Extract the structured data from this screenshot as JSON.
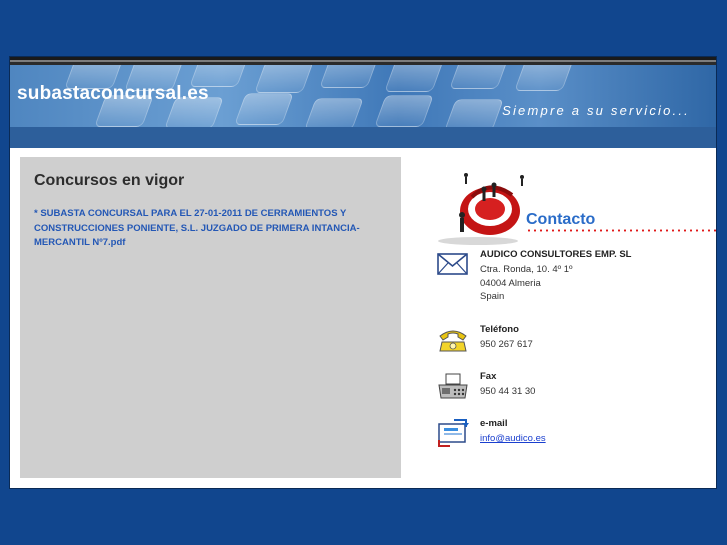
{
  "header": {
    "site_title": "subastaconcursal.es",
    "tagline": "Siempre a su servicio..."
  },
  "left_panel": {
    "heading": "Concursos en vigor",
    "link_text": "* SUBASTA CONCURSAL PARA EL 27-01-2011 DE CERRAMIENTOS Y CONSTRUCCIONES PONIENTE, S.L. JUZGADO DE PRIMERA INTANCIA-MERCANTIL Nº7.pdf"
  },
  "contact": {
    "title": "Contacto",
    "company": {
      "name": "AUDICO CONSULTORES EMP. SL",
      "address_line1": "Ctra. Ronda, 10. 4º 1º",
      "address_line2": "04004 Almeria",
      "address_line3": "Spain",
      "icon": "envelope-icon"
    },
    "phone": {
      "label": "Teléfono",
      "value": "950 267 617",
      "icon": "telephone-icon"
    },
    "fax": {
      "label": "Fax",
      "value": "950 44 31 30",
      "icon": "fax-icon"
    },
    "email": {
      "label": "e-mail",
      "value": "info@audico.es",
      "icon": "email-icon"
    }
  },
  "colors": {
    "page_background": "#11468e",
    "banner_blue": "#4f86c0",
    "panel_gray": "#cfcfcf",
    "link_blue": "#2357b5",
    "contact_blue": "#2a6cc8",
    "accent_red": "#e01818"
  }
}
